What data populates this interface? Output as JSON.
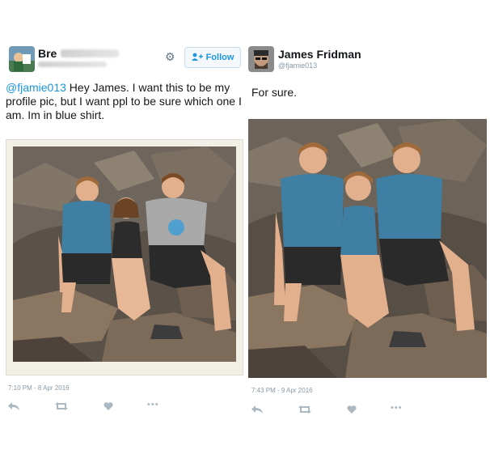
{
  "left_tweet": {
    "display_name": "Bre",
    "follow_label": "Follow",
    "text_mention": "@fjamie013",
    "text_body": " Hey James. I want this to be my profile pic, but I want ppl to be sure which one I am. Im in blue shirt.",
    "timestamp": "7:10 PM - 8 Apr 2016"
  },
  "right_tweet": {
    "display_name": "James Fridman",
    "handle": "@fjamie013",
    "text": "For sure.",
    "timestamp": "7:43 PM - 9 Apr 2016"
  },
  "icons": {
    "settings": "gear-icon",
    "follow": "add-user-icon",
    "reply": "reply-icon",
    "retweet": "retweet-icon",
    "like": "heart-icon",
    "more": "more-icon"
  },
  "colors": {
    "link": "#1b95e0",
    "action_icons": "#aab8c2",
    "muted_text": "#8899a6",
    "photo_frame": "#f1efe6"
  }
}
